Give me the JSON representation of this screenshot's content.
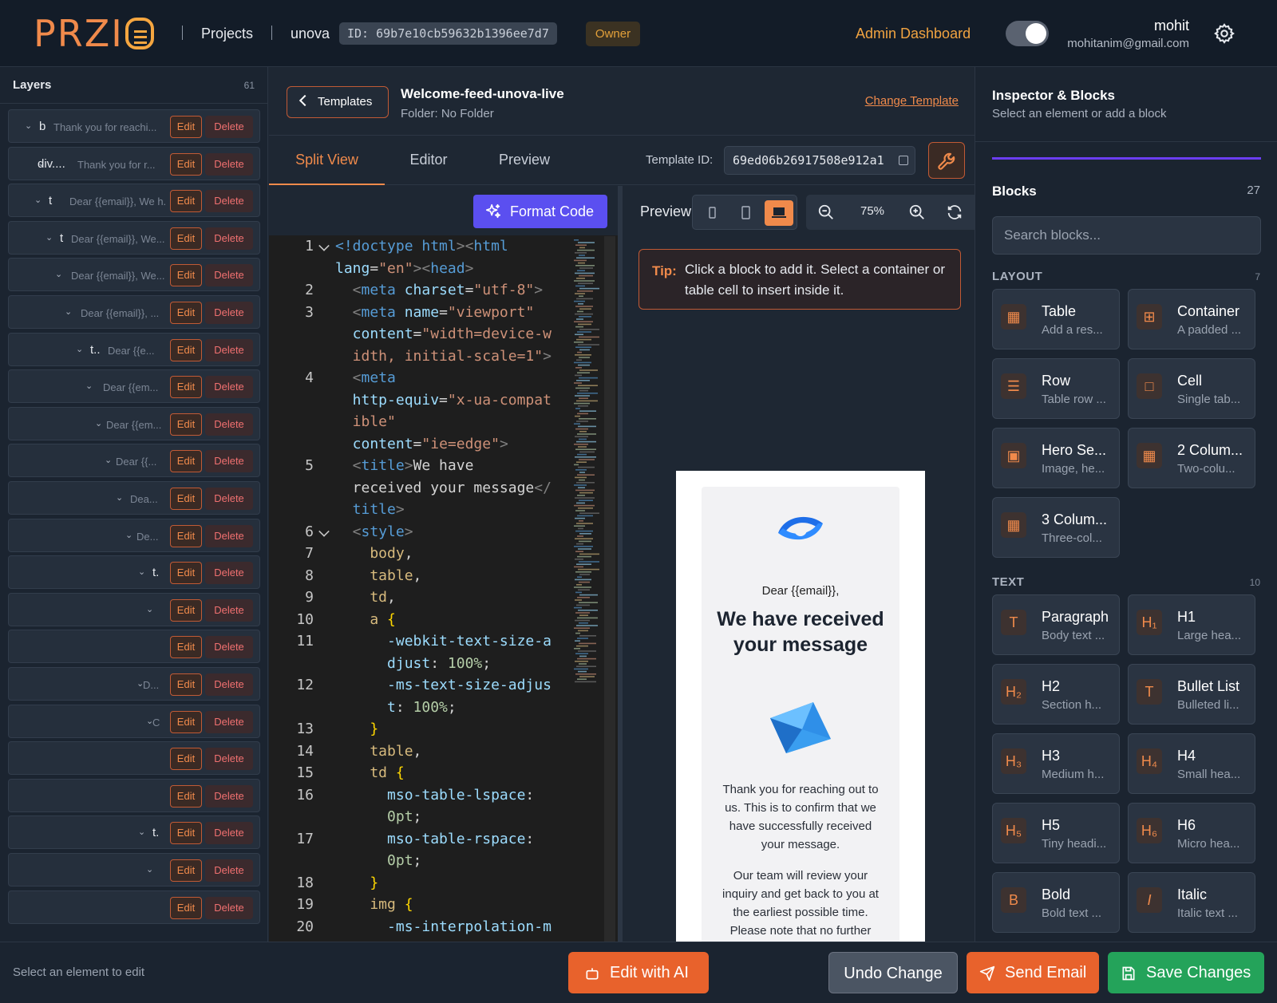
{
  "header": {
    "logo_text": "PRZI",
    "projects": "Projects",
    "project_name": "unova",
    "project_id": "ID: 69b7e10cb59632b1396ee7d7",
    "role": "Owner",
    "admin_link": "Admin Dashboard",
    "theme_toggle_on": true,
    "user_name": "mohit",
    "user_email": "mohitanim@gmail.com"
  },
  "layers": {
    "title": "Layers",
    "count": "61",
    "edit_label": "Edit",
    "delete_label": "Delete",
    "rows": [
      {
        "tag": "b",
        "desc": "Thank you for reachi..."
      },
      {
        "tag": "div....",
        "desc": "Thank you for r..."
      },
      {
        "tag": "t",
        "desc": "Dear {{email}}, We h..."
      },
      {
        "tag": "t",
        "desc": "Dear {{email}}, We..."
      },
      {
        "tag": "",
        "desc": "Dear {{email}}, We..."
      },
      {
        "tag": "",
        "desc": "Dear {{email}}, ..."
      },
      {
        "tag": "t..",
        "desc": "Dear {{e..."
      },
      {
        "tag": "",
        "desc": "Dear {{em..."
      },
      {
        "tag": "",
        "desc": "Dear {{em..."
      },
      {
        "tag": "",
        "desc": "Dear {{..."
      },
      {
        "tag": "",
        "desc": "Dea..."
      },
      {
        "tag": "",
        "desc": "De..."
      },
      {
        "tag": "t.",
        "desc": ""
      },
      {
        "tag": "",
        "desc": ""
      },
      {
        "tag": "",
        "desc": ""
      },
      {
        "tag": "",
        "desc": "D..."
      },
      {
        "tag": "",
        "desc": "C"
      },
      {
        "tag": "",
        "desc": ""
      },
      {
        "tag": "",
        "desc": ""
      },
      {
        "tag": "t.",
        "desc": ""
      },
      {
        "tag": "",
        "desc": ""
      },
      {
        "tag": "",
        "desc": ""
      }
    ]
  },
  "template": {
    "back_label": "Templates",
    "name": "Welcome-feed-unova-live",
    "folder": "Folder: No Folder",
    "change_label": "Change Template",
    "tabs": [
      "Split View",
      "Editor",
      "Preview"
    ],
    "active_tab": "Split View",
    "id_label": "Template ID:",
    "id_value": "69ed06b26917508e912a1"
  },
  "editor": {
    "format_label": "Format Code",
    "line_numbers": [
      "1",
      "",
      "2",
      "3",
      "",
      "",
      "4",
      "",
      "",
      "",
      "5",
      "",
      "",
      "6",
      "7",
      "8",
      "9",
      "10",
      "11",
      "",
      "12",
      "",
      "13",
      "14",
      "15",
      "16",
      "",
      "17",
      "",
      "18",
      "19",
      "20"
    ],
    "lines": [
      [
        {
          "t": "<!doctype ",
          "c": "#569cd6"
        },
        {
          "t": "html",
          "c": "#569cd6"
        },
        {
          "t": "><",
          "c": "#808080"
        },
        {
          "t": "html",
          "c": "#569cd6"
        }
      ],
      [
        {
          "t": "lang",
          "c": "#9cdcfe"
        },
        {
          "t": "=",
          "c": "#d4d4d4"
        },
        {
          "t": "\"en\"",
          "c": "#ce9178"
        },
        {
          "t": "><",
          "c": "#808080"
        },
        {
          "t": "head",
          "c": "#569cd6"
        },
        {
          "t": ">",
          "c": "#808080"
        }
      ],
      [
        {
          "t": "  <",
          "c": "#808080"
        },
        {
          "t": "meta ",
          "c": "#569cd6"
        },
        {
          "t": "charset",
          "c": "#9cdcfe"
        },
        {
          "t": "=",
          "c": "#d4d4d4"
        },
        {
          "t": "\"utf-8\"",
          "c": "#ce9178"
        },
        {
          "t": ">",
          "c": "#808080"
        }
      ],
      [
        {
          "t": "  <",
          "c": "#808080"
        },
        {
          "t": "meta ",
          "c": "#569cd6"
        },
        {
          "t": "name",
          "c": "#9cdcfe"
        },
        {
          "t": "=",
          "c": "#d4d4d4"
        },
        {
          "t": "\"viewport\"",
          "c": "#ce9178"
        }
      ],
      [
        {
          "t": "  content",
          "c": "#9cdcfe"
        },
        {
          "t": "=",
          "c": "#d4d4d4"
        },
        {
          "t": "\"width=device-w",
          "c": "#ce9178"
        }
      ],
      [
        {
          "t": "  idth, initial-scale=1\"",
          "c": "#ce9178"
        },
        {
          "t": ">",
          "c": "#808080"
        }
      ],
      [
        {
          "t": "  <",
          "c": "#808080"
        },
        {
          "t": "meta",
          "c": "#569cd6"
        }
      ],
      [
        {
          "t": "  http-equiv",
          "c": "#9cdcfe"
        },
        {
          "t": "=",
          "c": "#d4d4d4"
        },
        {
          "t": "\"x-ua-compat",
          "c": "#ce9178"
        }
      ],
      [
        {
          "t": "  ible\"",
          "c": "#ce9178"
        }
      ],
      [
        {
          "t": "  content",
          "c": "#9cdcfe"
        },
        {
          "t": "=",
          "c": "#d4d4d4"
        },
        {
          "t": "\"ie=edge\"",
          "c": "#ce9178"
        },
        {
          "t": ">",
          "c": "#808080"
        }
      ],
      [
        {
          "t": "  <",
          "c": "#808080"
        },
        {
          "t": "title",
          "c": "#569cd6"
        },
        {
          "t": ">",
          "c": "#808080"
        },
        {
          "t": "We have",
          "c": "#d4d4d4"
        }
      ],
      [
        {
          "t": "  received your message",
          "c": "#d4d4d4"
        },
        {
          "t": "</",
          "c": "#808080"
        }
      ],
      [
        {
          "t": "  title",
          "c": "#569cd6"
        },
        {
          "t": ">",
          "c": "#808080"
        }
      ],
      [
        {
          "t": "  <",
          "c": "#808080"
        },
        {
          "t": "style",
          "c": "#569cd6"
        },
        {
          "t": ">",
          "c": "#808080"
        }
      ],
      [
        {
          "t": "    body",
          "c": "#d7ba7d"
        },
        {
          "t": ",",
          "c": "#d4d4d4"
        }
      ],
      [
        {
          "t": "    table",
          "c": "#d7ba7d"
        },
        {
          "t": ",",
          "c": "#d4d4d4"
        }
      ],
      [
        {
          "t": "    td",
          "c": "#d7ba7d"
        },
        {
          "t": ",",
          "c": "#d4d4d4"
        }
      ],
      [
        {
          "t": "    a ",
          "c": "#d7ba7d"
        },
        {
          "t": "{",
          "c": "#ffd700"
        }
      ],
      [
        {
          "t": "      -webkit-text-size-a",
          "c": "#9cdcfe"
        }
      ],
      [
        {
          "t": "      djust",
          "c": "#9cdcfe"
        },
        {
          "t": ": ",
          "c": "#d4d4d4"
        },
        {
          "t": "100%",
          "c": "#b5cea8"
        },
        {
          "t": ";",
          "c": "#d4d4d4"
        }
      ],
      [
        {
          "t": "      -ms-text-size-adjus",
          "c": "#9cdcfe"
        }
      ],
      [
        {
          "t": "      t",
          "c": "#9cdcfe"
        },
        {
          "t": ": ",
          "c": "#d4d4d4"
        },
        {
          "t": "100%",
          "c": "#b5cea8"
        },
        {
          "t": ";",
          "c": "#d4d4d4"
        }
      ],
      [
        {
          "t": "    }",
          "c": "#ffd700"
        }
      ],
      [
        {
          "t": "    table",
          "c": "#d7ba7d"
        },
        {
          "t": ",",
          "c": "#d4d4d4"
        }
      ],
      [
        {
          "t": "    td ",
          "c": "#d7ba7d"
        },
        {
          "t": "{",
          "c": "#ffd700"
        }
      ],
      [
        {
          "t": "      mso-table-lspace",
          "c": "#9cdcfe"
        },
        {
          "t": ":",
          "c": "#d4d4d4"
        }
      ],
      [
        {
          "t": "      0pt",
          "c": "#b5cea8"
        },
        {
          "t": ";",
          "c": "#d4d4d4"
        }
      ],
      [
        {
          "t": "      mso-table-rspace",
          "c": "#9cdcfe"
        },
        {
          "t": ":",
          "c": "#d4d4d4"
        }
      ],
      [
        {
          "t": "      0pt",
          "c": "#b5cea8"
        },
        {
          "t": ";",
          "c": "#d4d4d4"
        }
      ],
      [
        {
          "t": "    }",
          "c": "#ffd700"
        }
      ],
      [
        {
          "t": "    img ",
          "c": "#d7ba7d"
        },
        {
          "t": "{",
          "c": "#ffd700"
        }
      ],
      [
        {
          "t": "      -ms-interpolation-m",
          "c": "#9cdcfe"
        }
      ]
    ]
  },
  "preview": {
    "label": "Preview",
    "zoom": "75%",
    "tip_label": "Tip:",
    "tip_text": "Click a block to add it. Select a container or table cell to insert inside it.",
    "email": {
      "greeting": "Dear {{email}},",
      "title": "We have received your message",
      "p1": "Thank you for reaching out to us. This is to confirm that we have successfully received your message.",
      "p2": "Our team will review your inquiry and get back to you at the earliest possible time. Please note that no further action is required from your side at this stage."
    }
  },
  "inspector": {
    "title": "Inspector & Blocks",
    "subtitle": "Select an element or add a block",
    "blocks_title": "Blocks",
    "blocks_count": "27",
    "search_placeholder": "Search blocks...",
    "sections": [
      {
        "label": "LAYOUT",
        "count": "7",
        "blocks": [
          {
            "name": "Table",
            "desc": "Add a res...",
            "icon": "table-icon"
          },
          {
            "name": "Container",
            "desc": "A padded ...",
            "icon": "grid-icon"
          },
          {
            "name": "Row",
            "desc": "Table row ...",
            "icon": "rows-icon"
          },
          {
            "name": "Cell",
            "desc": "Single tab...",
            "icon": "square-icon"
          },
          {
            "name": "Hero Se...",
            "desc": "Image, he...",
            "icon": "image-icon"
          },
          {
            "name": "2 Colum...",
            "desc": "Two-colu...",
            "icon": "table-icon"
          },
          {
            "name": "3 Colum...",
            "desc": "Three-col...",
            "icon": "table-icon"
          }
        ]
      },
      {
        "label": "TEXT",
        "count": "10",
        "blocks": [
          {
            "name": "Paragraph",
            "desc": "Body text ...",
            "icon": "T"
          },
          {
            "name": "H1",
            "desc": "Large hea...",
            "icon": "H₁"
          },
          {
            "name": "H2",
            "desc": "Section h...",
            "icon": "H₂"
          },
          {
            "name": "Bullet List",
            "desc": "Bulleted li...",
            "icon": "T"
          },
          {
            "name": "H3",
            "desc": "Medium h...",
            "icon": "H₃"
          },
          {
            "name": "H4",
            "desc": "Small hea...",
            "icon": "H₄"
          },
          {
            "name": "H5",
            "desc": "Tiny headi...",
            "icon": "H₅"
          },
          {
            "name": "H6",
            "desc": "Micro hea...",
            "icon": "H₆"
          },
          {
            "name": "Bold",
            "desc": "Bold text ...",
            "icon": "B"
          },
          {
            "name": "Italic",
            "desc": "Italic text ...",
            "icon": "I"
          }
        ]
      }
    ]
  },
  "footer": {
    "hint": "Select an element to edit",
    "ai_label": "Edit with AI",
    "undo_label": "Undo Change",
    "send_label": "Send Email",
    "save_label": "Save Changes"
  }
}
